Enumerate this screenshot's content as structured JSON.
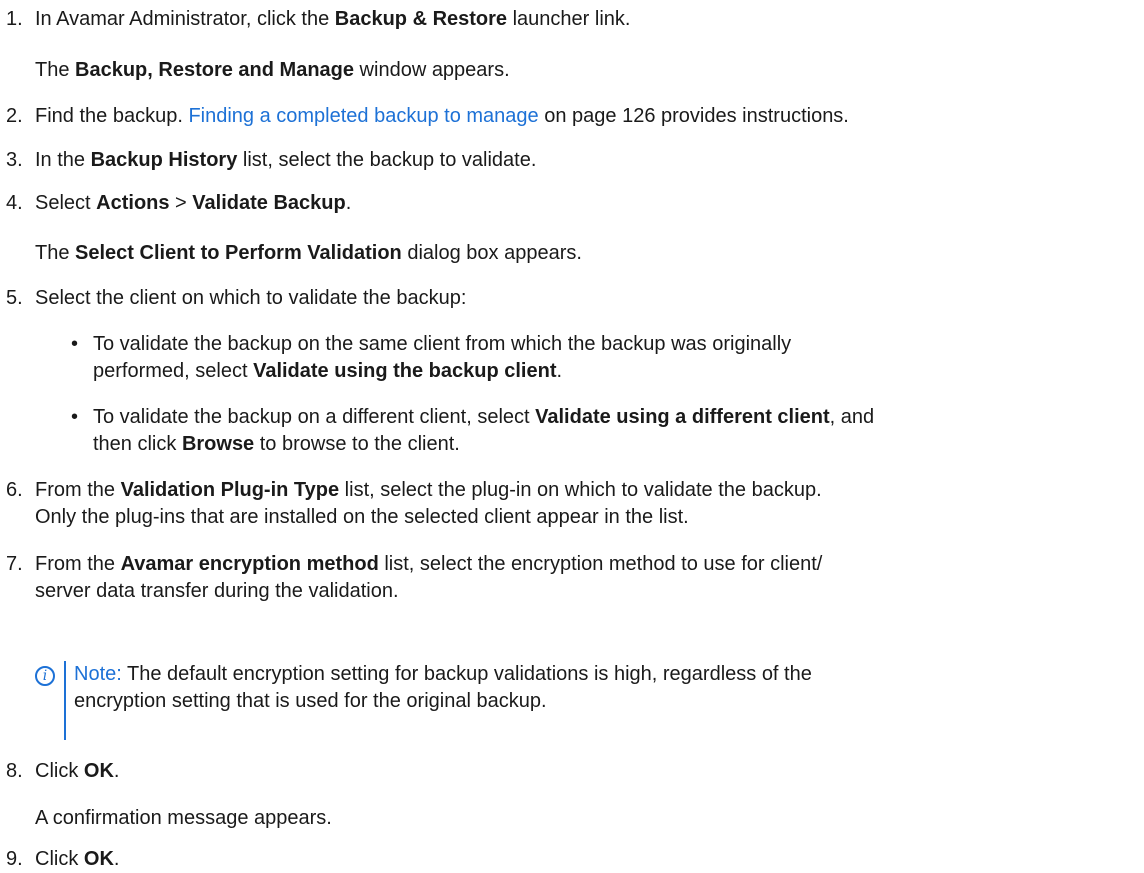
{
  "steps": [
    {
      "num": "1.",
      "a": "In Avamar Administrator, click the ",
      "b": "Backup & Restore",
      "c": " launcher link."
    },
    {
      "sub_a": "The ",
      "sub_b": "Backup, Restore and Manage",
      "sub_c": " window appears."
    },
    {
      "num": "2.",
      "a": "Find the backup. ",
      "link": "Finding a completed backup to manage",
      "c": " on page 126 provides instructions."
    },
    {
      "num": "3.",
      "a": "In the ",
      "b": "Backup History",
      "c": " list, select the backup to validate."
    },
    {
      "num": "4.",
      "a": "Select ",
      "b": "Actions",
      "mid": " > ",
      "b2": "Validate Backup",
      "c": "."
    },
    {
      "sub_a": "The ",
      "sub_b": "Select Client to Perform Validation",
      "sub_c": " dialog box appears."
    },
    {
      "num": "5.",
      "a": "Select the client on which to validate the backup:"
    },
    {
      "bullet": "•",
      "a": "To validate the backup on the same client from which the backup was originally"
    },
    {
      "a": "performed, select ",
      "b": "Validate using the backup client",
      "c": "."
    },
    {
      "bullet": "•",
      "a": "To validate the backup on a different client, select ",
      "b": "Validate using a different client",
      "c": ", and"
    },
    {
      "a": "then click ",
      "b": "Browse",
      "c": " to browse to the client."
    },
    {
      "num": "6.",
      "a": "From the ",
      "b": "Validation Plug-in Type",
      "c": " list, select the plug-in on which to validate the backup."
    },
    {
      "a": "Only the plug-ins that are installed on the selected client appear in the list."
    },
    {
      "num": "7.",
      "a": "From the ",
      "b": "Avamar encryption method",
      "c": " list, select the encryption method to use for client/"
    },
    {
      "a": "server data transfer during the validation."
    },
    {
      "note_label": "Note:",
      "a": " The default encryption setting for backup validations is high, regardless of the"
    },
    {
      "a": "encryption setting that is used for the original backup."
    },
    {
      "num": "8.",
      "a": "Click ",
      "b": "OK",
      "c": "."
    },
    {
      "a": "A confirmation message appears."
    },
    {
      "num": "9.",
      "a": "Click ",
      "b": "OK",
      "c": "."
    }
  ],
  "note_icon": "info-circle-icon",
  "link_color": "#1d71d6"
}
